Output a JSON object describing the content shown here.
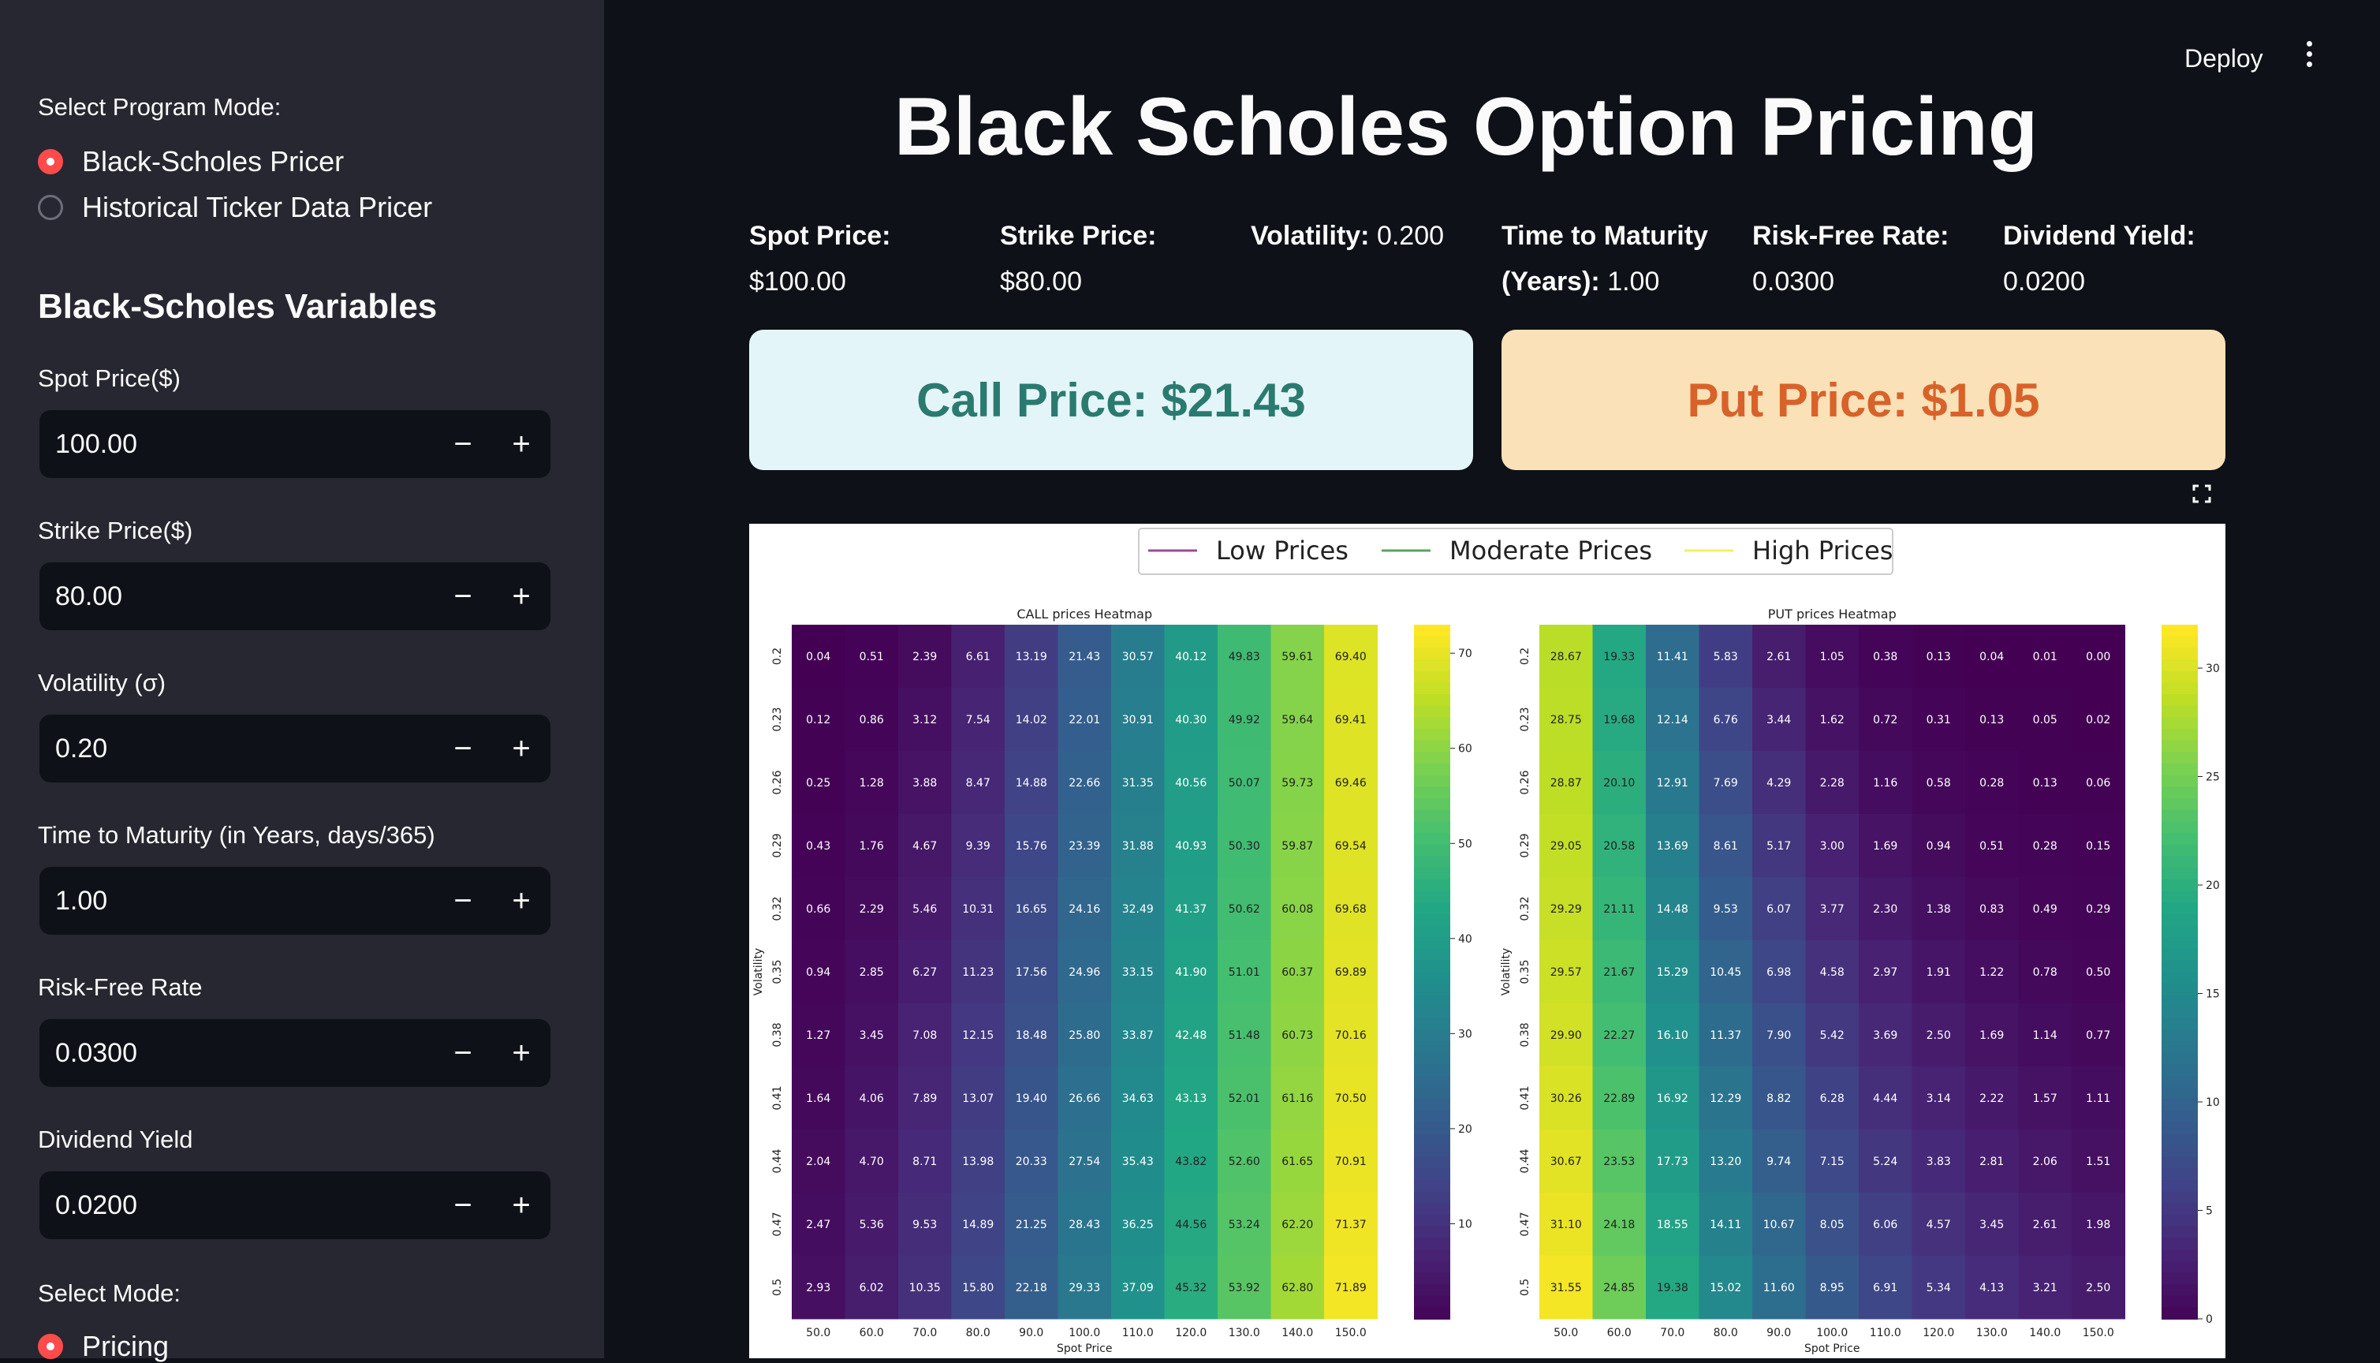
{
  "sidebar": {
    "program_mode_label": "Select Program Mode:",
    "program_modes": [
      {
        "label": "Black-Scholes Pricer",
        "selected": true
      },
      {
        "label": "Historical Ticker Data Pricer",
        "selected": false
      }
    ],
    "variables_heading": "Black-Scholes Variables",
    "inputs": [
      {
        "label": "Spot Price($)",
        "value": "100.00"
      },
      {
        "label": "Strike Price($)",
        "value": "80.00"
      },
      {
        "label": "Volatility (σ)",
        "value": "0.20"
      },
      {
        "label": "Time to Maturity (in Years, days/365)",
        "value": "1.00"
      },
      {
        "label": "Risk-Free Rate",
        "value": "0.0300"
      },
      {
        "label": "Dividend Yield",
        "value": "0.0200"
      }
    ],
    "minus_label": "−",
    "plus_label": "+",
    "mode_label": "Select Mode:",
    "modes": [
      {
        "label": "Pricing",
        "selected": true
      }
    ]
  },
  "header": {
    "deploy_label": "Deploy",
    "menu_icon": "kebab-menu-icon"
  },
  "main": {
    "title": "Black Scholes Option Pricing",
    "metrics": [
      {
        "label": "Spot Price:",
        "value": "$100.00"
      },
      {
        "label": "Strike Price:",
        "value": "$80.00"
      },
      {
        "label": "Volatility:",
        "value": "0.200"
      },
      {
        "label": "Time to Maturity (Years):",
        "value": "1.00"
      },
      {
        "label": "Risk-Free Rate:",
        "value": "0.0300"
      },
      {
        "label": "Dividend Yield:",
        "value": "0.0200"
      }
    ],
    "call_price": "Call Price: $21.43",
    "put_price": "Put Price: $1.05",
    "colors": {
      "call_bg": "#e3f5f8",
      "call_text": "#2b7a6f",
      "put_bg": "#fae1b7",
      "put_text": "#d8622a",
      "accent": "#ff4b4b"
    },
    "expand_icon": "fullscreen-icon"
  },
  "chart_data": [
    {
      "type": "heatmap",
      "title": "CALL prices Heatmap",
      "xlabel": "Spot Price",
      "ylabel": "Volatility",
      "x": [
        "50.0",
        "60.0",
        "70.0",
        "80.0",
        "90.0",
        "100.0",
        "110.0",
        "120.0",
        "130.0",
        "140.0",
        "150.0"
      ],
      "y": [
        "0.2",
        "0.23",
        "0.26",
        "0.29",
        "0.32",
        "0.35",
        "0.38",
        "0.41",
        "0.44",
        "0.47",
        "0.5"
      ],
      "values": [
        [
          0.04,
          0.51,
          2.39,
          6.61,
          13.19,
          21.43,
          30.57,
          40.12,
          49.83,
          59.61,
          69.4
        ],
        [
          0.12,
          0.86,
          3.12,
          7.54,
          14.02,
          22.01,
          30.91,
          40.3,
          49.92,
          59.64,
          69.41
        ],
        [
          0.25,
          1.28,
          3.88,
          8.47,
          14.88,
          22.66,
          31.35,
          40.56,
          50.07,
          59.73,
          69.46
        ],
        [
          0.43,
          1.76,
          4.67,
          9.39,
          15.76,
          23.39,
          31.88,
          40.93,
          50.3,
          59.87,
          69.54
        ],
        [
          0.66,
          2.29,
          5.46,
          10.31,
          16.65,
          24.16,
          32.49,
          41.37,
          50.62,
          60.08,
          69.68
        ],
        [
          0.94,
          2.85,
          6.27,
          11.23,
          17.56,
          24.96,
          33.15,
          41.9,
          51.01,
          60.37,
          69.89
        ],
        [
          1.27,
          3.45,
          7.08,
          12.15,
          18.48,
          25.8,
          33.87,
          42.48,
          51.48,
          60.73,
          70.16
        ],
        [
          1.64,
          4.06,
          7.89,
          13.07,
          19.4,
          26.66,
          34.63,
          43.13,
          52.01,
          61.16,
          70.5
        ],
        [
          2.04,
          4.7,
          8.71,
          13.98,
          20.33,
          27.54,
          35.43,
          43.82,
          52.6,
          61.65,
          70.91
        ],
        [
          2.47,
          5.36,
          9.53,
          14.89,
          21.25,
          28.43,
          36.25,
          44.56,
          53.24,
          62.2,
          71.37
        ],
        [
          2.93,
          6.02,
          10.35,
          15.8,
          22.18,
          29.33,
          37.09,
          45.32,
          53.92,
          62.8,
          71.89
        ]
      ],
      "colorbar_ticks": [
        10,
        20,
        30,
        40,
        50,
        60,
        70
      ],
      "vmin": 0,
      "vmax": 73
    },
    {
      "type": "heatmap",
      "title": "PUT prices Heatmap",
      "xlabel": "Spot Price",
      "ylabel": "Volatility",
      "x": [
        "50.0",
        "60.0",
        "70.0",
        "80.0",
        "90.0",
        "100.0",
        "110.0",
        "120.0",
        "130.0",
        "140.0",
        "150.0"
      ],
      "y": [
        "0.2",
        "0.23",
        "0.26",
        "0.29",
        "0.32",
        "0.35",
        "0.38",
        "0.41",
        "0.44",
        "0.47",
        "0.5"
      ],
      "values": [
        [
          28.67,
          19.33,
          11.41,
          5.83,
          2.61,
          1.05,
          0.38,
          0.13,
          0.04,
          0.01,
          0.0
        ],
        [
          28.75,
          19.68,
          12.14,
          6.76,
          3.44,
          1.62,
          0.72,
          0.31,
          0.13,
          0.05,
          0.02
        ],
        [
          28.87,
          20.1,
          12.91,
          7.69,
          4.29,
          2.28,
          1.16,
          0.58,
          0.28,
          0.13,
          0.06
        ],
        [
          29.05,
          20.58,
          13.69,
          8.61,
          5.17,
          3.0,
          1.69,
          0.94,
          0.51,
          0.28,
          0.15
        ],
        [
          29.29,
          21.11,
          14.48,
          9.53,
          6.07,
          3.77,
          2.3,
          1.38,
          0.83,
          0.49,
          0.29
        ],
        [
          29.57,
          21.67,
          15.29,
          10.45,
          6.98,
          4.58,
          2.97,
          1.91,
          1.22,
          0.78,
          0.5
        ],
        [
          29.9,
          22.27,
          16.1,
          11.37,
          7.9,
          5.42,
          3.69,
          2.5,
          1.69,
          1.14,
          0.77
        ],
        [
          30.26,
          22.89,
          16.92,
          12.29,
          8.82,
          6.28,
          4.44,
          3.14,
          2.22,
          1.57,
          1.11
        ],
        [
          30.67,
          23.53,
          17.73,
          13.2,
          9.74,
          7.15,
          5.24,
          3.83,
          2.81,
          2.06,
          1.51
        ],
        [
          31.1,
          24.18,
          18.55,
          14.11,
          10.67,
          8.05,
          6.06,
          4.57,
          3.45,
          2.61,
          1.98
        ],
        [
          31.55,
          24.85,
          19.38,
          15.02,
          11.6,
          8.95,
          6.91,
          5.34,
          4.13,
          3.21,
          2.5
        ]
      ],
      "colorbar_ticks": [
        0,
        5,
        10,
        15,
        20,
        25,
        30
      ],
      "vmin": 0,
      "vmax": 32
    }
  ],
  "legend": {
    "placement": "top-center",
    "entries": [
      {
        "name": "Low Prices",
        "color": "#9b4b9e"
      },
      {
        "name": "Moderate Prices",
        "color": "#5aa55a"
      },
      {
        "name": "High Prices",
        "color": "#f2f25a"
      }
    ]
  }
}
